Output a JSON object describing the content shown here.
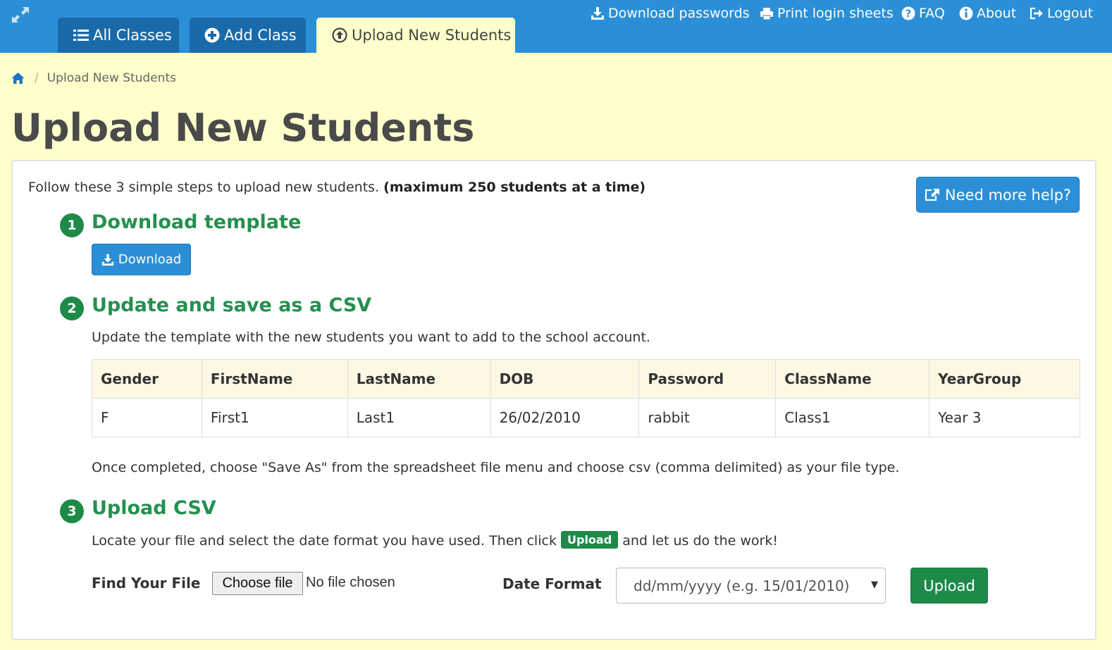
{
  "topbar": {
    "tabs": [
      {
        "label": "All Classes",
        "icon": "list-icon"
      },
      {
        "label": "Add Class",
        "icon": "plus-circle-icon"
      },
      {
        "label": "Upload New Students",
        "icon": "upload-circle-icon",
        "active": true
      }
    ],
    "nav": {
      "download_passwords": "Download passwords",
      "print_login_sheets": "Print login sheets",
      "faq": "FAQ",
      "about": "About",
      "logout": "Logout"
    }
  },
  "breadcrumb": {
    "current": "Upload New Students"
  },
  "page": {
    "title": "Upload New Students",
    "intro": "Follow these 3 simple steps to upload new students.",
    "intro_bold": "(maximum 250 students at a time)",
    "help_button": "Need more help?"
  },
  "steps": [
    {
      "number": "1",
      "title": "Download template",
      "button": "Download"
    },
    {
      "number": "2",
      "title": "Update and save as a CSV",
      "description": "Update the template with the new students you want to add to the school account.",
      "footer": "Once completed, choose \"Save As\" from the spreadsheet file menu and choose csv (comma delimited) as your file type."
    },
    {
      "number": "3",
      "title": "Upload CSV",
      "description_before": "Locate your file and select the date format you have used. Then click",
      "description_badge": "Upload",
      "description_after": "and let us do the work!"
    }
  ],
  "template_table": {
    "headers": [
      "Gender",
      "FirstName",
      "LastName",
      "DOB",
      "Password",
      "ClassName",
      "YearGroup"
    ],
    "rows": [
      [
        "F",
        "First1",
        "Last1",
        "26/02/2010",
        "rabbit",
        "Class1",
        "Year 3"
      ]
    ]
  },
  "upload_form": {
    "file_label": "Find Your File",
    "choose_file_button": "Choose file",
    "file_status": "No file chosen",
    "date_format_label": "Date Format",
    "date_format_selected": "dd/mm/yyyy (e.g. 15/01/2010)",
    "upload_button": "Upload"
  },
  "colors": {
    "topbar": "#2a8fd6",
    "tab_dark": "#1a6aa9",
    "page_background": "#ffffcc",
    "step_green": "#23914f",
    "button_blue": "#2a8fd6",
    "button_green": "#1e8a4a"
  }
}
